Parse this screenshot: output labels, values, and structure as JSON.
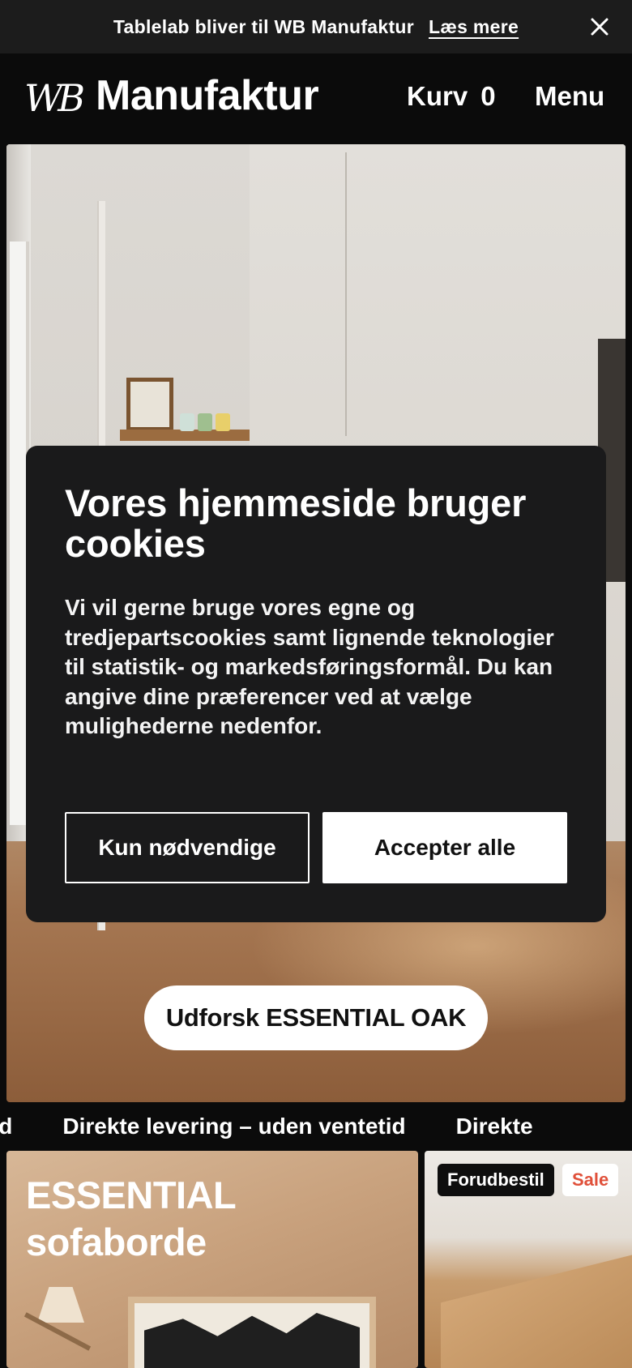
{
  "announcement": {
    "message": "Tablelab bliver til WB Manufaktur",
    "link_label": "Læs mere",
    "close_icon": "close-icon"
  },
  "header": {
    "logo_monogram": "WB",
    "logo_text": "Manufaktur",
    "cart_label": "Kurv",
    "cart_count": "0",
    "menu_label": "Menu"
  },
  "cookie_banner": {
    "title": "Vores hjemmeside bruger cookies",
    "body": "Vi vil gerne bruge vores egne og tredjepartscookies samt lignende teknologier til statistik- og markedsføringsformål. Du kan angive dine præferencer ved at vælge mulighederne nedenfor.",
    "necessary_label": "Kun nødvendige",
    "accept_label": "Accepter alle"
  },
  "hero": {
    "cta_label": "Udforsk ESSENTIAL OAK"
  },
  "marquee": {
    "items": [
      "ventetid",
      "Direkte levering – uden ventetid",
      "Direkte"
    ]
  },
  "cards": {
    "left": {
      "title_line1": "ESSENTIAL",
      "title_line2": "sofaborde"
    },
    "right": {
      "badge_preorder": "Forudbestil",
      "badge_sale": "Sale"
    }
  },
  "colors": {
    "background": "#0b0b0b",
    "announcement_bg": "#1c1c1c",
    "cookie_bg": "#1a1a1b",
    "sale_text": "#e0503a"
  }
}
